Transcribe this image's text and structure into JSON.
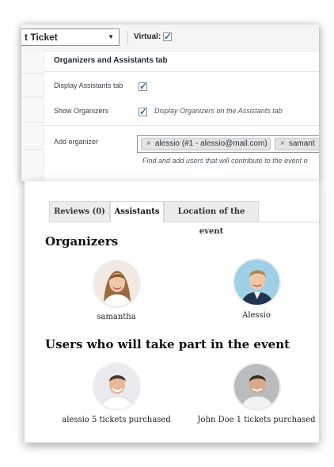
{
  "admin": {
    "product_type_select": "t Ticket",
    "virtual_label": "Virtual:",
    "virtual_checked": true,
    "section_title": "Organizers and Assistants tab",
    "display_assistants_label": "Display Assistants tab",
    "display_assistants_checked": true,
    "show_organizers_label": "Show Organizers",
    "show_organizers_checked": true,
    "show_organizers_desc": "Display Organizers on the Assistants tab",
    "add_organizer_label": "Add organizer",
    "organizer_tags": [
      "alessio (#1 - alessio@mail.com)",
      "samant"
    ],
    "add_organizer_help": "Find and add users that will contribute to the event o"
  },
  "front": {
    "tabs": [
      "Reviews (0)",
      "Assistants",
      "Location of the event"
    ],
    "active_tab": "Assistants",
    "organizers_heading": "Organizers",
    "organizers": [
      {
        "name": "samantha",
        "avatar": "woman-avatar"
      },
      {
        "name": "Alessio",
        "avatar": "man-avatar"
      }
    ],
    "participants_heading": "Users who will take part in the event",
    "participants": [
      {
        "name": "alessio 5 tickets purchased",
        "avatar": "man-avatar"
      },
      {
        "name": "John Doe 1 tickets purchased",
        "avatar": "man-avatar"
      }
    ]
  },
  "colors": {
    "checkbox_check": "#2271b1",
    "admin_bg": "#ffffff",
    "tab_inactive_bg": "#ececec"
  }
}
